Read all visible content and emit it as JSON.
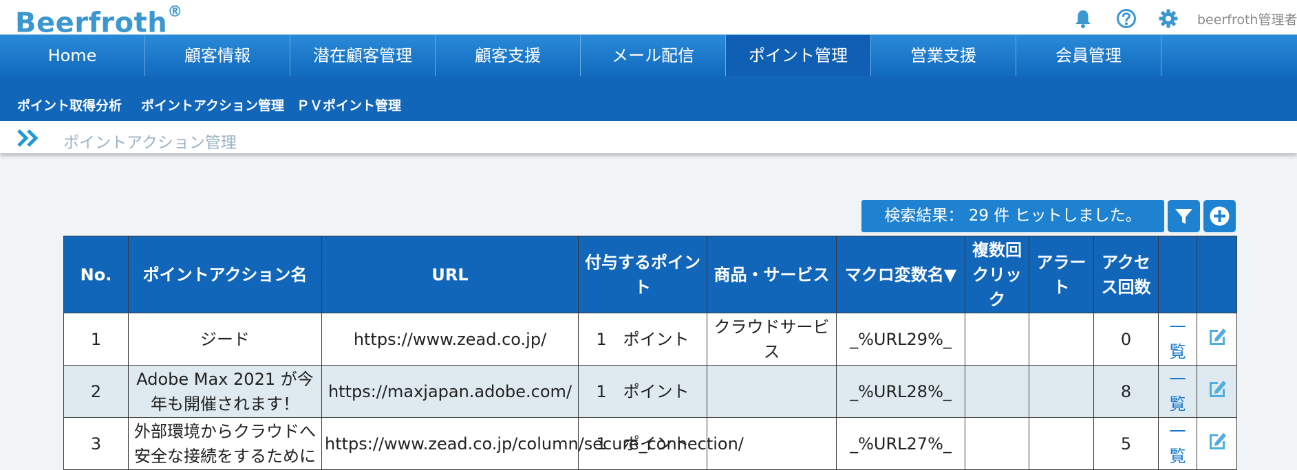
{
  "app": {
    "logo": "Beerfroth",
    "logo_mark": "®",
    "user": "beerfroth管理者"
  },
  "top_icons": [
    {
      "name": "bell-icon"
    },
    {
      "name": "help-icon"
    },
    {
      "name": "gear-icon"
    }
  ],
  "nav": [
    {
      "label": "Home"
    },
    {
      "label": "顧客情報"
    },
    {
      "label": "潜在顧客管理"
    },
    {
      "label": "顧客支援"
    },
    {
      "label": "メール配信"
    },
    {
      "label": "ポイント管理",
      "active": true
    },
    {
      "label": "営業支援"
    },
    {
      "label": "会員管理"
    }
  ],
  "subnav": [
    {
      "label": "ポイント取得分析"
    },
    {
      "label": "ポイントアクション管理"
    },
    {
      "label": "ＰＶポイント管理"
    }
  ],
  "page_title": "ポイントアクション管理",
  "result": {
    "text": "検索結果： 29 件 ヒットしました。"
  },
  "table": {
    "headers": [
      "No.",
      "ポイントアクション名",
      "URL",
      "付与するポイント",
      "商品・サービス",
      "マクロ変数名▼",
      "複数回クリック",
      "アラート",
      "アクセス回数"
    ],
    "rows": [
      {
        "no": "1",
        "name": "ジード",
        "url": "https://www.zead.co.jp/",
        "points": "1　ポイント",
        "service": "クラウドサービス",
        "macro": "_%URL29%_",
        "multi": "",
        "alert": "",
        "access": "0",
        "list_link": "一覧"
      },
      {
        "no": "2",
        "name": "Adobe Max 2021 が今年も開催されます！",
        "url": "https://maxjapan.adobe.com/",
        "points": "1　ポイント",
        "service": "",
        "macro": "_%URL28%_",
        "multi": "",
        "alert": "",
        "access": "8",
        "list_link": "一覧"
      },
      {
        "no": "3",
        "name": "外部環境からクラウドへ安全な接続をするために",
        "url": "https://www.zead.co.jp/column/secure_connection/",
        "points": "1　ポイント",
        "service": "",
        "macro": "_%URL27%_",
        "multi": "",
        "alert": "",
        "access": "5",
        "list_link": "一覧"
      }
    ]
  },
  "colors": {
    "nav": "#1b7bd0",
    "subnav": "#1166b9",
    "accent": "#1f82d0",
    "row_alt": "#deeaef"
  }
}
